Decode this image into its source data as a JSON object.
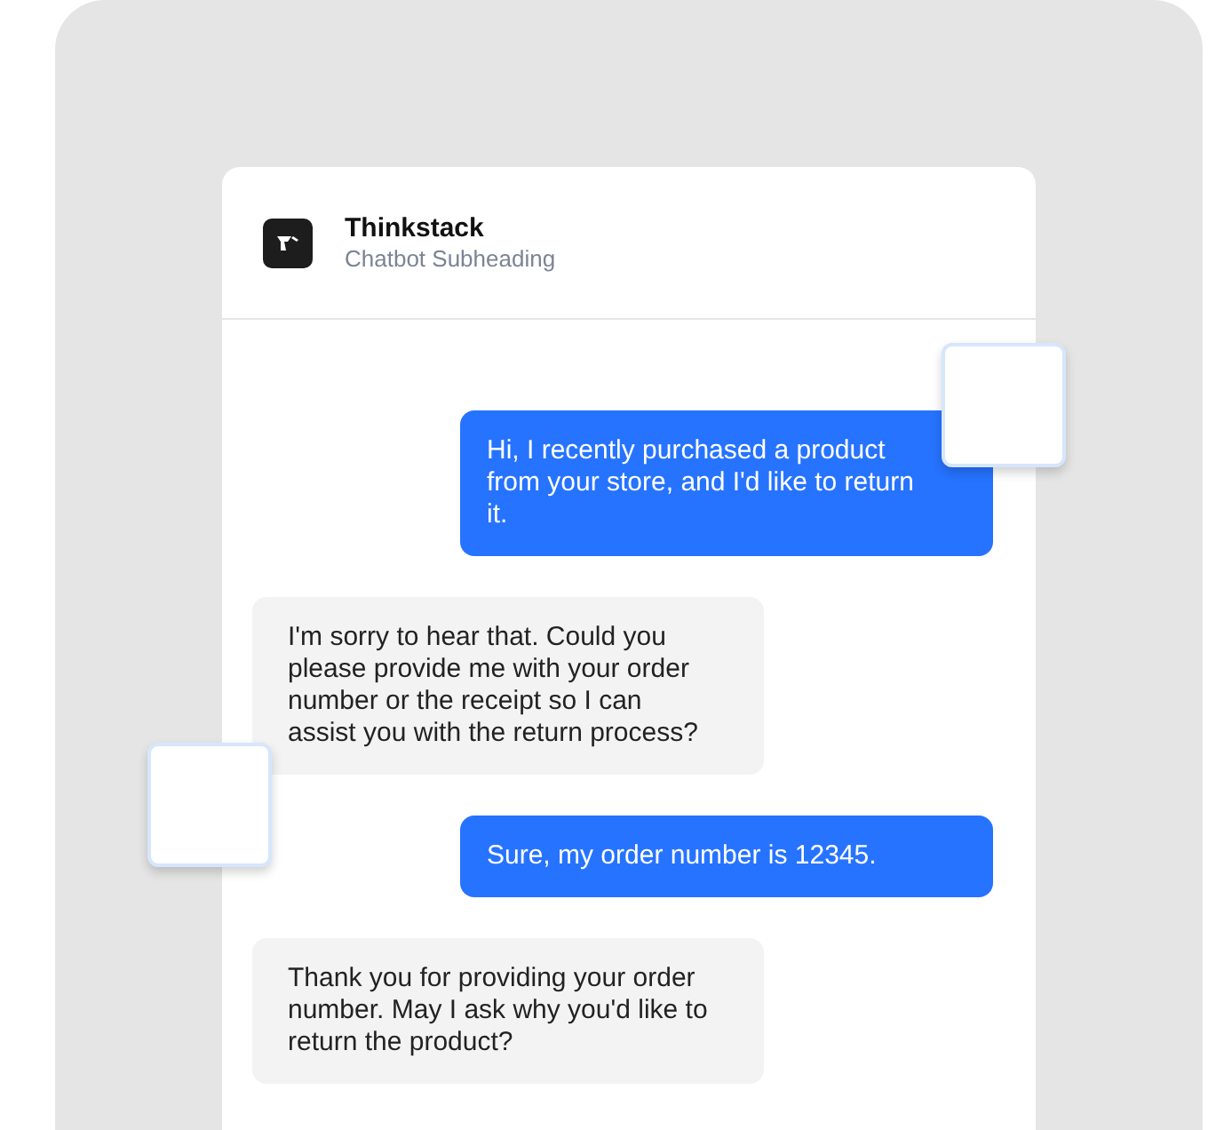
{
  "header": {
    "title": "Thinkstack",
    "subtitle": "Chatbot Subheading"
  },
  "messages": [
    {
      "kind": "user",
      "text": "Hi, I recently purchased a product from your store, and I'd like to return it."
    },
    {
      "kind": "bot",
      "text": "I'm sorry to hear that. Could you please provide me with your order number or the receipt so I can assist you with the return process?"
    },
    {
      "kind": "user",
      "text": "Sure, my order number is 12345."
    },
    {
      "kind": "bot",
      "text": "Thank you for providing your order number. May I ask why you'd like to return the product?"
    }
  ]
}
